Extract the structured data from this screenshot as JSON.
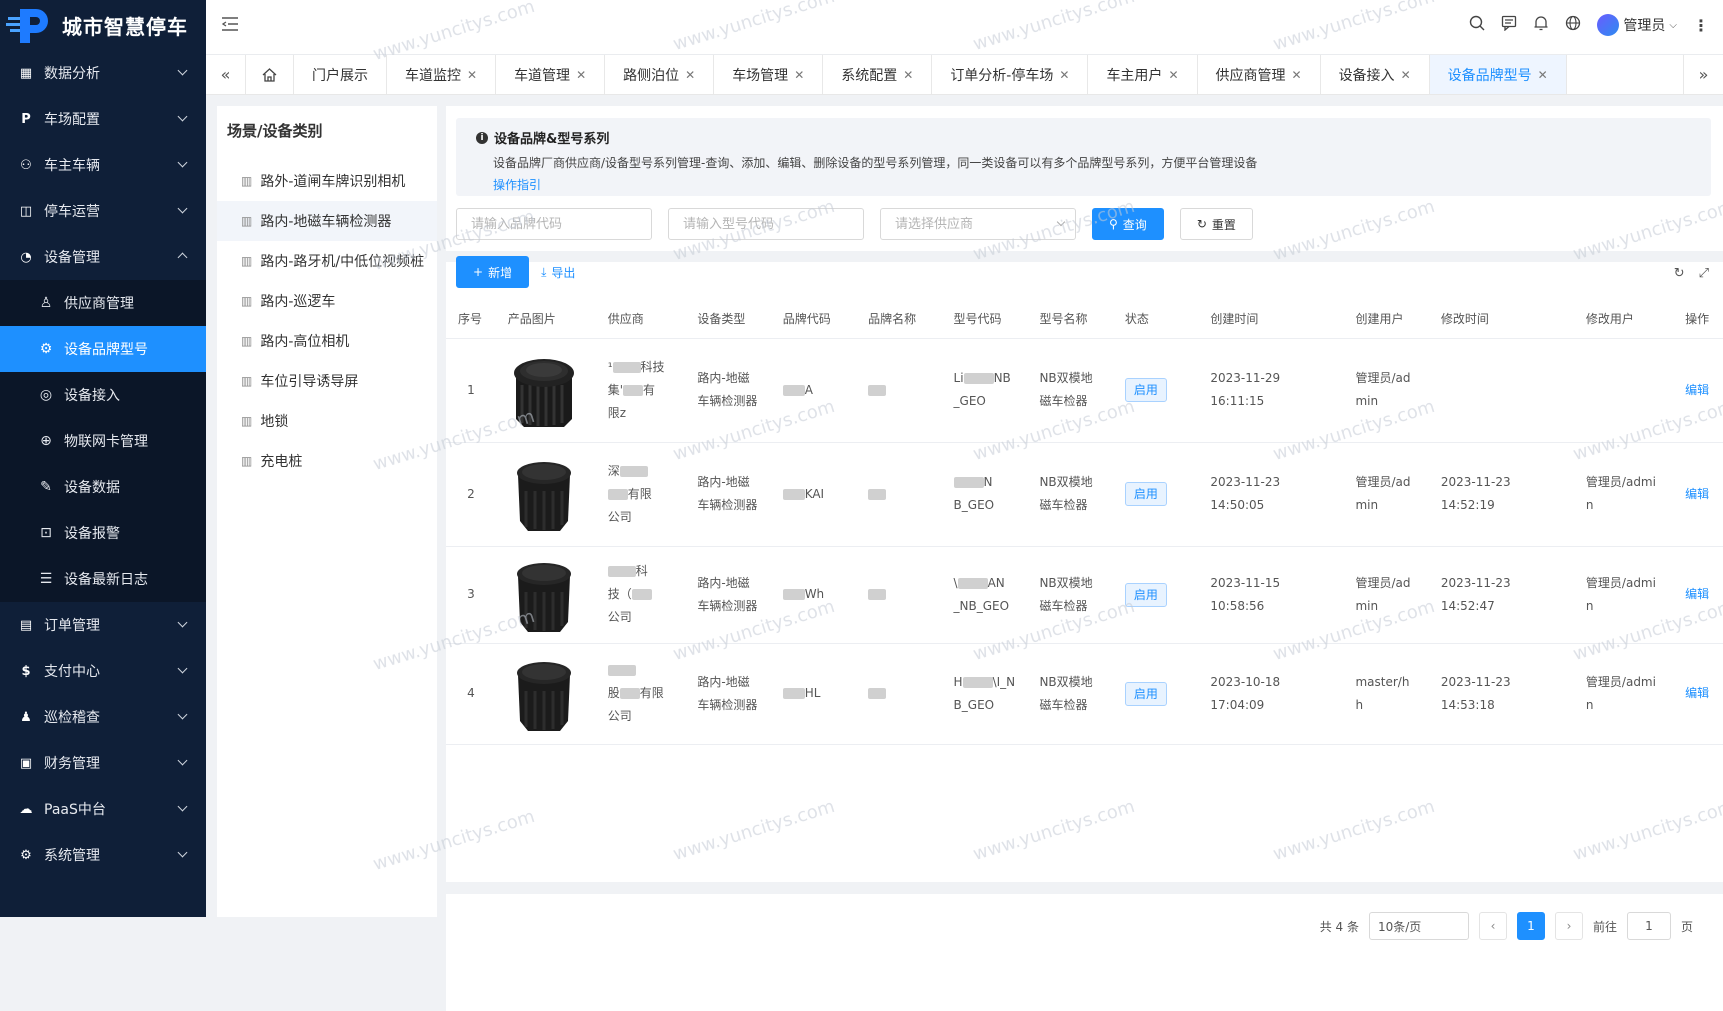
{
  "app": {
    "title": "城市智慧停车"
  },
  "sidebar": {
    "items": [
      {
        "label": "数据分析",
        "icon": "grid-icon"
      },
      {
        "label": "车场配置",
        "icon": "parking-icon"
      },
      {
        "label": "车主车辆",
        "icon": "users-icon"
      },
      {
        "label": "停车运营",
        "icon": "book-icon"
      },
      {
        "label": "设备管理",
        "icon": "gauge-icon"
      }
    ],
    "sub_items": [
      {
        "label": "供应商管理",
        "icon": "user-icon"
      },
      {
        "label": "设备品牌型号",
        "icon": "chip-icon"
      },
      {
        "label": "设备接入",
        "icon": "target-icon"
      },
      {
        "label": "物联网卡管理",
        "icon": "globe-icon"
      },
      {
        "label": "设备数据",
        "icon": "pencil-icon"
      },
      {
        "label": "设备报警",
        "icon": "alarm-icon"
      },
      {
        "label": "设备最新日志",
        "icon": "list-icon"
      }
    ],
    "items_after": [
      {
        "label": "订单管理",
        "icon": "clipboard-icon"
      },
      {
        "label": "支付中心",
        "icon": "dollar-icon"
      },
      {
        "label": "巡检稽查",
        "icon": "inspector-icon"
      },
      {
        "label": "财务管理",
        "icon": "finance-icon"
      },
      {
        "label": "PaaS中台",
        "icon": "cloud-icon"
      },
      {
        "label": "系统管理",
        "icon": "settings-icon"
      }
    ]
  },
  "header": {
    "user": "管理员"
  },
  "tabs": [
    {
      "label": "门户展示"
    },
    {
      "label": "车道监控"
    },
    {
      "label": "车道管理"
    },
    {
      "label": "路侧泊位"
    },
    {
      "label": "车场管理"
    },
    {
      "label": "系统配置"
    },
    {
      "label": "订单分析-停车场"
    },
    {
      "label": "车主用户"
    },
    {
      "label": "供应商管理"
    },
    {
      "label": "设备接入"
    },
    {
      "label": "设备品牌型号",
      "active": true
    }
  ],
  "categories": {
    "title": "场景/设备类别",
    "items": [
      "路外-道闸车牌识别相机",
      "路内-地磁车辆检测器",
      "路内-路牙机/中低位视频桩",
      "路内-巡逻车",
      "路内-高位相机",
      "车位引导诱导屏",
      "地锁",
      "充电桩"
    ]
  },
  "info": {
    "title": "设备品牌&型号系列",
    "desc": "设备品牌厂商供应商/设备型号系列管理-查询、添加、编辑、删除设备的型号系列管理，同一类设备可以有多个品牌型号系列，方便平台管理设备",
    "link": "操作指引"
  },
  "filters": {
    "brand_placeholder": "请输入品牌代码",
    "model_placeholder": "请输入型号代码",
    "supplier_placeholder": "请选择供应商",
    "query": "查询",
    "reset": "重置"
  },
  "actions": {
    "add": "新增",
    "export": "导出"
  },
  "table": {
    "headers": [
      "序号",
      "产品图片",
      "供应商",
      "设备类型",
      "品牌代码",
      "品牌名称",
      "型号代码",
      "型号名称",
      "状态",
      "创建时间",
      "创建用户",
      "修改时间",
      "修改用户",
      "操作"
    ],
    "rows": [
      {
        "no": "1",
        "supplier": [
          "¹",
          "集'",
          "限z"
        ],
        "supplier_tail": [
          "科技",
          "有",
          ""
        ],
        "type": "路内-地磁车辆检测器",
        "brand_code": "A",
        "brand_name": "",
        "model_code": [
          "Li",
          "NB",
          "_GEO"
        ],
        "model_name": "NB双模地磁车检器",
        "status": "启用",
        "created": "2023-11-29 16:11:15",
        "creator": "管理员/admin",
        "modified": "",
        "modifier": "",
        "op": "编辑"
      },
      {
        "no": "2",
        "supplier": [
          "深",
          "",
          "公司"
        ],
        "supplier_tail": [
          "",
          "有限",
          ""
        ],
        "type": "路内-地磁车辆检测器",
        "brand_code": "KAI",
        "brand_name": "",
        "model_code": [
          "",
          "N",
          "B_GEO"
        ],
        "model_name": "NB双模地磁车检器",
        "status": "启用",
        "created": "2023-11-23 14:50:05",
        "creator": "管理员/admin",
        "modified": "2023-11-23 14:52:19",
        "modifier": "管理员/admin",
        "op": "编辑"
      },
      {
        "no": "3",
        "supplier": [
          "",
          "技（",
          ""
        ],
        "supplier_tail": [
          "科",
          "",
          "公司"
        ],
        "type": "路内-地磁车辆检测器",
        "brand_code": "Wh",
        "brand_name": "",
        "model_code": [
          "\\",
          "AN",
          "_NB_GEO"
        ],
        "model_name": "NB双模地磁车检器",
        "status": "启用",
        "created": "2023-11-15 10:58:56",
        "creator": "管理员/admin",
        "modified": "2023-11-23 14:52:47",
        "modifier": "管理员/admin",
        "op": "编辑"
      },
      {
        "no": "4",
        "supplier": [
          "",
          "股",
          "公司"
        ],
        "supplier_tail": [
          "",
          "有限",
          ""
        ],
        "type": "路内-地磁车辆检测器",
        "brand_code": "HL",
        "brand_name": "",
        "model_code": [
          "H",
          "\\I_N",
          "B_GEO"
        ],
        "model_name": "NB双模地磁车检器",
        "status": "启用",
        "created": "2023-10-18 17:04:09",
        "creator": "master/hh",
        "modified": "2023-11-23 14:53:18",
        "modifier": "管理员/admin",
        "op": "编辑"
      }
    ]
  },
  "pager": {
    "total": "共 4 条",
    "size": "10条/页",
    "current": "1",
    "goto": "前往",
    "goto_val": "1",
    "page": "页"
  },
  "watermark": "www.yuncitys.com",
  "colors": {
    "primary": "#1e90ff",
    "sidebar": "#0f1f38"
  }
}
